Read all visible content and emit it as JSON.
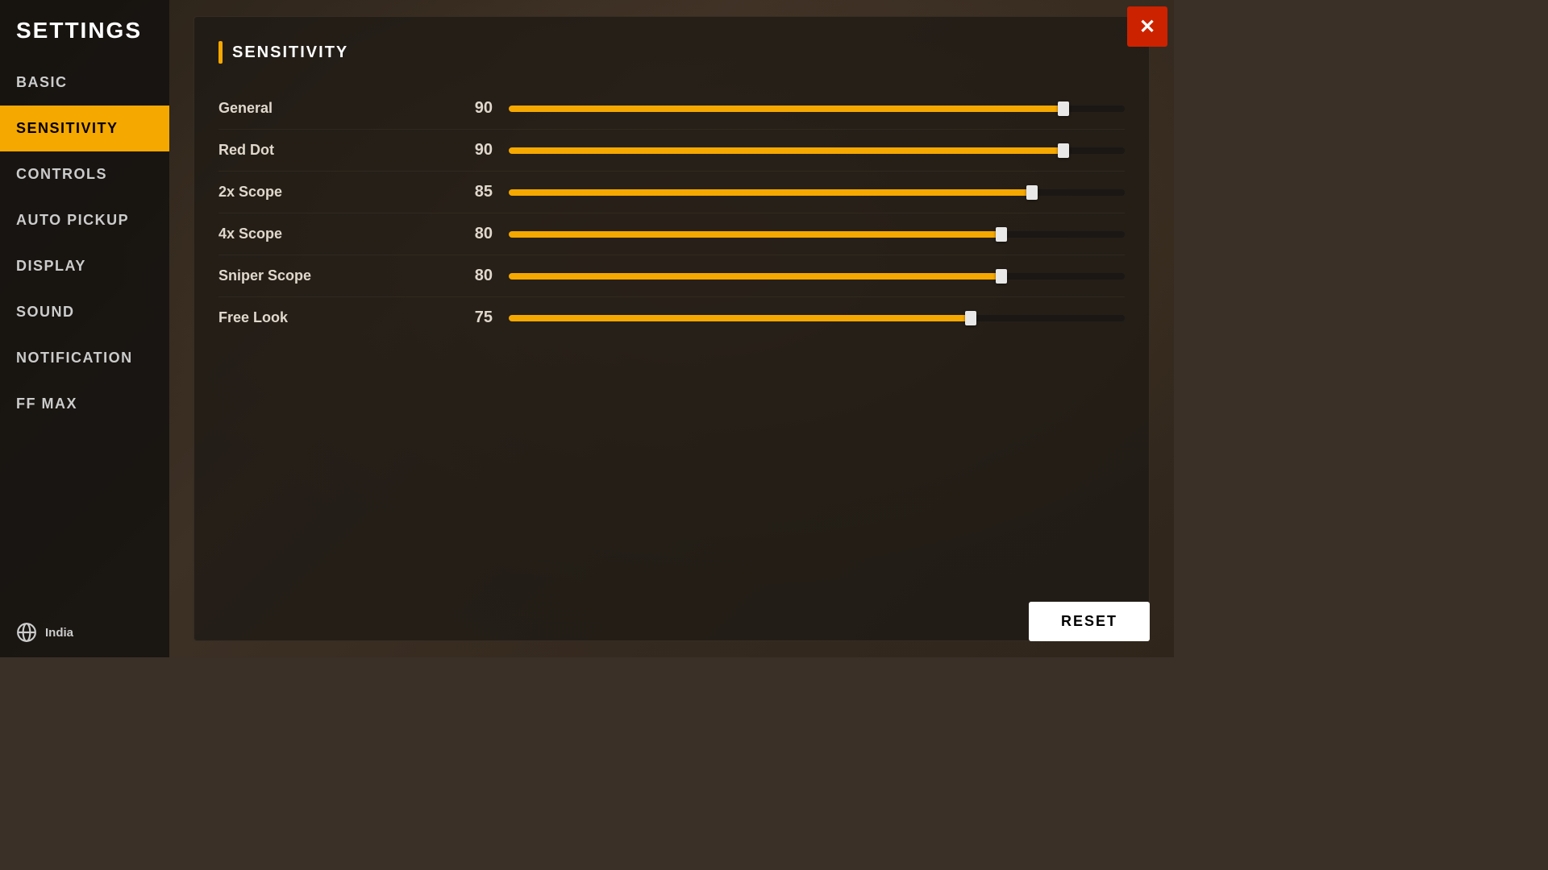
{
  "app": {
    "title": "SETTINGS"
  },
  "sidebar": {
    "items": [
      {
        "id": "basic",
        "label": "BASIC",
        "active": false
      },
      {
        "id": "sensitivity",
        "label": "SENSITIVITY",
        "active": true
      },
      {
        "id": "controls",
        "label": "CONTROLS",
        "active": false
      },
      {
        "id": "auto-pickup",
        "label": "AUTO PICKUP",
        "active": false
      },
      {
        "id": "display",
        "label": "DISPLAY",
        "active": false
      },
      {
        "id": "sound",
        "label": "SOUND",
        "active": false
      },
      {
        "id": "notification",
        "label": "NOTIFICATION",
        "active": false
      },
      {
        "id": "ff-max",
        "label": "FF MAX",
        "active": false
      }
    ],
    "footer": {
      "region": "India"
    }
  },
  "main": {
    "section_title": "SENSITIVITY",
    "sliders": [
      {
        "label": "General",
        "value": 90,
        "max": 100,
        "percent": 90
      },
      {
        "label": "Red Dot",
        "value": 90,
        "max": 100,
        "percent": 90
      },
      {
        "label": "2x Scope",
        "value": 85,
        "max": 100,
        "percent": 85
      },
      {
        "label": "4x Scope",
        "value": 80,
        "max": 100,
        "percent": 80
      },
      {
        "label": "Sniper Scope",
        "value": 80,
        "max": 100,
        "percent": 80
      },
      {
        "label": "Free Look",
        "value": 75,
        "max": 100,
        "percent": 75
      }
    ]
  },
  "buttons": {
    "reset_label": "RESET",
    "close_label": "✕"
  }
}
